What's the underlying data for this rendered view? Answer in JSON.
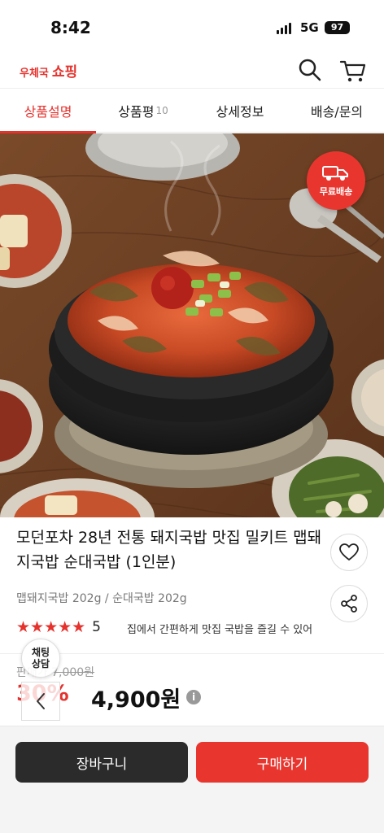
{
  "status_bar": {
    "time": "8:42",
    "network": "5G",
    "battery": "97"
  },
  "header": {
    "logo_part1": "우체국",
    "logo_part2": "쇼핑",
    "brand_color": "#e5322d"
  },
  "tabs": [
    {
      "label": "상품설명",
      "active": true
    },
    {
      "label": "상품평",
      "count": "10"
    },
    {
      "label": "상세정보"
    },
    {
      "label": "배송/문의"
    }
  ],
  "badge": {
    "free_shipping": "무료배송"
  },
  "product": {
    "title": "모던포차 28년 전통 돼지국밥 맛집 밀키트 맵돼지국밥 순대국밥 (1인분)",
    "subtitle": "맵돼지국밥 202g / 순대국밥 202g",
    "rating_score": "5",
    "stars": "★★★★★",
    "promo_text": "집에서 간편하게 맛집 국밥을 즐길 수 있어",
    "original_price_label": "판매가",
    "original_price": "7,000원",
    "discount": "30%",
    "sale_price": "4,900원"
  },
  "floating": {
    "chat_label_1": "채팅",
    "chat_label_2": "상담"
  },
  "actions": {
    "cart_label": "장바구니",
    "buy_label": "구매하기"
  }
}
